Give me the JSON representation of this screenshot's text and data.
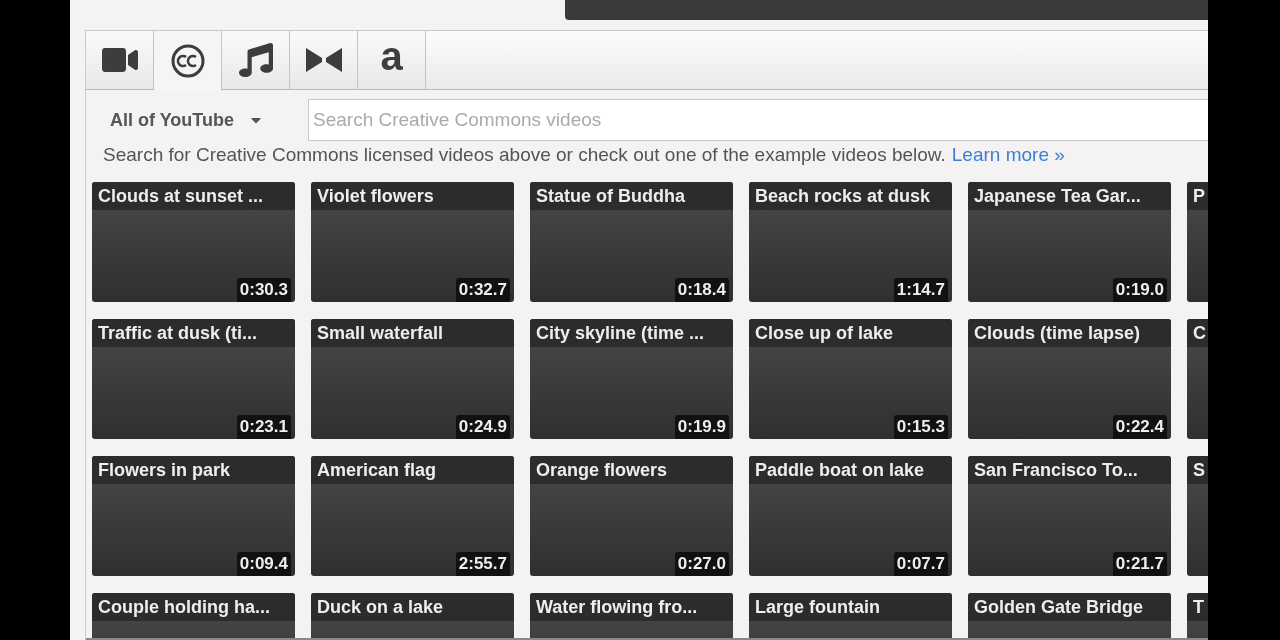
{
  "tabs": [
    {
      "kind": "video",
      "selected": false
    },
    {
      "kind": "cc",
      "selected": true
    },
    {
      "kind": "music",
      "selected": false
    },
    {
      "kind": "bowtie",
      "selected": false
    },
    {
      "kind": "letter",
      "label": "a",
      "selected": false
    }
  ],
  "scope_dropdown": {
    "label": "All of YouTube"
  },
  "search": {
    "placeholder": "Search Creative Commons videos"
  },
  "intro": {
    "text": "Search for Creative Commons licensed videos above or check out one of the example videos below.",
    "link": "Learn more »"
  },
  "videos": [
    {
      "title": "Clouds at sunset ...",
      "duration": "0:30.3"
    },
    {
      "title": "Violet flowers",
      "duration": "0:32.7"
    },
    {
      "title": "Statue of Buddha",
      "duration": "0:18.4"
    },
    {
      "title": "Beach rocks at dusk",
      "duration": "1:14.7"
    },
    {
      "title": "Japanese Tea Gar...",
      "duration": "0:19.0"
    },
    {
      "title": "P"
    },
    {
      "title": "Traffic at dusk (ti...",
      "duration": "0:23.1"
    },
    {
      "title": "Small waterfall",
      "duration": "0:24.9"
    },
    {
      "title": "City skyline (time ...",
      "duration": "0:19.9"
    },
    {
      "title": "Close up of lake",
      "duration": "0:15.3"
    },
    {
      "title": "Clouds (time lapse)",
      "duration": "0:22.4"
    },
    {
      "title": "C"
    },
    {
      "title": "Flowers in park",
      "duration": "0:09.4"
    },
    {
      "title": "American flag",
      "duration": "2:55.7"
    },
    {
      "title": "Orange flowers",
      "duration": "0:27.0"
    },
    {
      "title": "Paddle boat on lake",
      "duration": "0:07.7"
    },
    {
      "title": "San Francisco To...",
      "duration": "0:21.7"
    },
    {
      "title": "S"
    },
    {
      "title": "Couple holding ha..."
    },
    {
      "title": "Duck on a lake"
    },
    {
      "title": "Water flowing fro..."
    },
    {
      "title": "Large fountain"
    },
    {
      "title": "Golden Gate Bridge"
    },
    {
      "title": "T"
    }
  ]
}
